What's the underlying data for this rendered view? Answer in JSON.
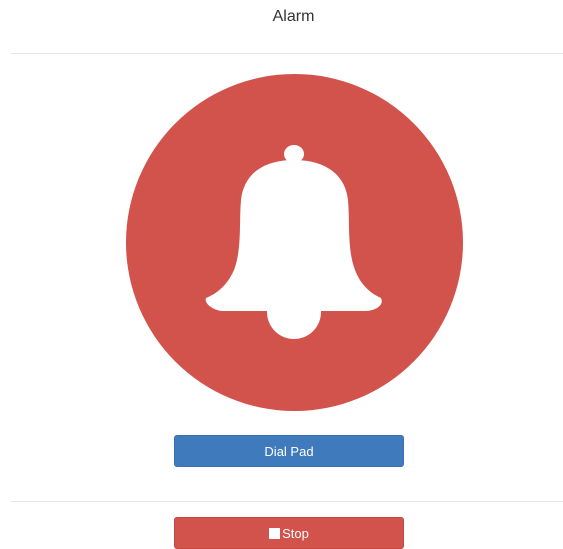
{
  "header": {
    "title": "Alarm"
  },
  "alarm": {
    "icon": "bell-icon",
    "circle_color": "#d2524c"
  },
  "actions": {
    "dial_pad_label": "Dial Pad",
    "dial_pad_color": "#3f7abc",
    "stop_label": "Stop",
    "stop_icon": "stop-square-icon",
    "stop_color": "#d2524c"
  }
}
